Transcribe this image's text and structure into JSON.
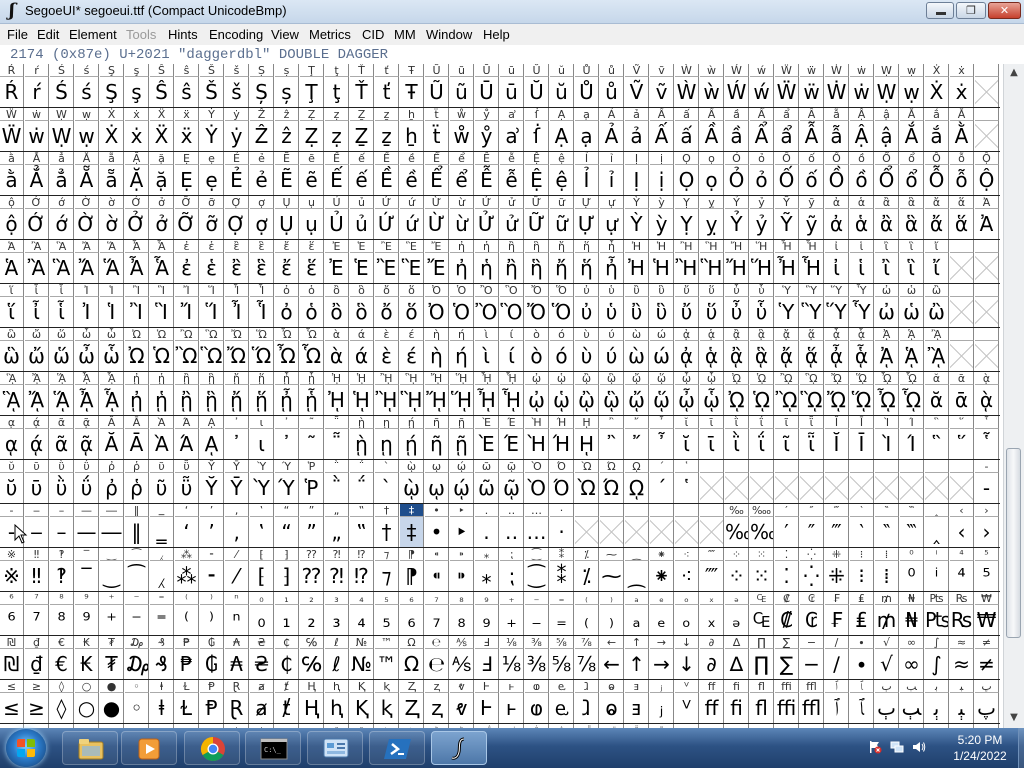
{
  "window": {
    "title": "SegoeUI* segoeui.ttf (Compact UnicodeBmp)",
    "app_icon_glyph": "ʃ",
    "min_label": "–",
    "max_label": "❐",
    "close_label": "✕"
  },
  "menu": [
    {
      "label": "File",
      "disabled": false
    },
    {
      "label": "Edit",
      "disabled": false
    },
    {
      "label": "Element",
      "disabled": false
    },
    {
      "label": "Tools",
      "disabled": true
    },
    {
      "label": "Hints",
      "disabled": false
    },
    {
      "label": "Encoding",
      "disabled": false
    },
    {
      "label": "View",
      "disabled": false
    },
    {
      "label": "Metrics",
      "disabled": false
    },
    {
      "label": "CID",
      "disabled": false
    },
    {
      "label": "MM",
      "disabled": false
    },
    {
      "label": "Window",
      "disabled": false
    },
    {
      "label": "Help",
      "disabled": false
    }
  ],
  "info": "2174 (0x87e) U+2021 \"daggerdbl\" DOUBLE DAGGER",
  "grid": {
    "rows": [
      "Ŕ ŕ Ś ś Ş ş Ŝ ŝ Š š Ș ș Ţ ţ Ť ť Ŧ Ũ ũ Ū ū Ŭ ŭ Ů ů Ṽ ṽ Ẁ ẁ Ẃ ẃ Ẅ ẅ Ẇ ẇ Ẉ ẉ Ẋ ẋ",
      "Ẅ ẇ Ẉ ẉ Ẋ ẋ Ẍ ẍ Ẏ ẏ Ẑ ẑ Ẓ ẓ Ẕ ẕ ẖ ẗ ẘ ẙ ẚ ẛ Ạ ạ Ả ả Ấ ấ Ầ ầ Ẩ ẩ Ẫ ẫ Ậ ậ Ắ ắ Ằ",
      "ằ Ẳ ẳ Ẵ ẵ Ặ ặ Ẹ ẹ Ẻ ẻ Ẽ ẽ Ế ế Ề ề Ể ể Ễ ễ Ệ ệ Ỉ ỉ Ị ị Ọ ọ Ỏ ỏ Ố ố Ồ ồ Ổ ổ Ỗ ỗ Ộ",
      "ộ Ớ ớ Ờ ờ Ở ở Ỡ ỡ Ợ ợ Ụ ụ Ủ ủ Ứ ứ Ừ ừ Ử ử Ữ ữ Ự ự Ỳ ỳ Ỵ ỵ Ỷ ỷ Ỹ ỹ ἀ ἁ ἂ ἃ ἄ ἅ Ἀ",
      "Ἁ Ἂ Ἃ Ἄ Ἅ Ἆ Ἇ ἐ ἑ ἒ ἓ ἔ ἕ Ἐ Ἑ Ἒ Ἓ Ἔ ἠ ἡ ἢ ἣ ἤ ἥ ἦ Ἠ Ἡ Ἢ Ἣ Ἤ Ἥ Ἦ Ἧ ἰ ἱ ἲ ἳ ἴ",
      "ἵ ἶ ἷ Ἰ Ἱ Ἲ Ἳ Ἴ Ἵ Ἶ Ἷ ὀ ὁ ὂ ὃ ὄ ὅ Ὀ Ὁ Ὂ Ὃ Ὄ Ὅ ὐ ὑ ὒ ὓ ὔ ὕ ὖ ὗ Ὑ Ὓ Ὕ Ὗ ὠ ὡ ὢ",
      "ὣ ὤ ὥ ὦ ὧ Ὠ Ὡ Ὢ Ὣ Ὤ Ὥ Ὦ Ὧ ὰ ά ὲ έ ὴ ή ὶ ί ὸ ό ὺ ύ ὼ ώ ᾀ ᾁ ᾂ ᾃ ᾄ ᾅ ᾆ ᾇ ᾈ ᾉ ᾊ",
      "ᾋ ᾌ ᾍ ᾎ ᾏ ᾐ ᾑ ᾒ ᾓ ᾔ ᾕ ᾖ ᾗ ᾘ ᾙ ᾚ ᾛ ᾜ ᾝ ᾞ ᾟ ᾠ ᾡ ᾢ ᾣ ᾤ ᾥ ᾦ ᾧ ᾨ ᾩ ᾪ ᾫ ᾬ ᾭ ᾮ ᾯ ᾰ ᾱ ᾲ",
      "ᾳ ᾴ ᾶ ᾷ Ᾰ Ᾱ Ὰ Ά ᾼ ᾽ ι ᾿ ῀ ῁ ῂ ῃ ῄ ῆ ῇ Ὲ Έ Ὴ Ή ῌ ῍ ῎ ῏ ῐ ῑ ῒ ΐ ῖ ῗ Ῐ Ῑ Ὶ Ί ῝ ῞ ῟",
      "ῠ ῡ ῢ ΰ ῤ ῥ ῦ ῧ Ῠ Ῡ Ὺ Ύ Ῥ ῭ ΅ ` ῲ ῳ ῴ ῶ ῷ Ὸ Ό Ὼ Ώ ῼ ´ ῾ ␣ ␣ ␣ ␣ ␣ ␣ ␣ ␣ ␣ ␣ ␣ ‐",
      "‑ ‒ – — ― ‖ ‗ ‘ ’ ‚ ‛ “ ” „ ‟ † ‡ • ‣ ․ ‥ … ‧ ␣ ␣ ␣ ␣ ␣ ␣ ‰ ‱ ′ ″ ‴ ‵ ‶ ‷ ‸ ‹ ›",
      "※ ‼ ‽ ‾ ‿ ⁀ ⁁ ⁂ ⁃ ⁄ ⁅ ⁆ ⁇ ⁈ ⁉ ⁊ ⁋ ⁌ ⁍ ⁎ ⁏ ⁐ ⁑ ⁒ ⁓ ⁔ ⁕ ⁖ ⁗ ⁘ ⁙ ⁚ ⁛ ⁜ ⁝ ⁞ ⁰ ⁱ ⁴ ⁵",
      "⁶ ⁷ ⁸ ⁹ ⁺ ⁻ ⁼ ⁽ ⁾ ⁿ ₀ ₁ ₂ ₃ ₄ ₅ ₆ ₇ ₈ ₉ ₊ ₋ ₌ ₍ ₎ ₐ ₑ ₒ ₓ ₔ ₠ ₡ ₢ ₣ ₤ ₥ ₦ ₧ ₨ ₩",
      "₪ ₫ € ₭ ₮ ₯ ₰ ₱ ₲ ₳ ₴ ₵ ℅ ℓ № ™ Ω ℮ ⅍ Ⅎ ⅛ ⅜ ⅝ ⅞ ← ↑ → ↓ ∂ ∆ ∏ ∑ − ∕ ∙ √ ∞ ∫ ≈ ≠",
      "≤ ≥ ◊ ○ ● ◦ ⱡ Ɫ Ᵽ Ɽ ⱥ ⱦ Ⱨ ⱨ Ⱪ ⱪ Ⱬ ⱬ ⱴ Ⱶ ⱶ ⱷ ⱸ ⱹ ⱺ ⱻ ⱼ ⱽ ﬀ ﬁ ﬂ ﬃ ﬄ ﭐ ﭑ ﭒ ﭓ ﭔ ﭕ ﭖ",
      "ﭗ ﭘ ﭙ ﭚ ﭛ ﭜ ﭝ ﭞ ﭟ ﭠ ﭡ ﭢ ﭣ ﭤ ﭥ ﭦ ﭧ ﭨ ﭩ ﭪ ﭫ ﭬ ﭭ ﭮ ﭯ ﭰ ﭱ ﭲ ﭳ ﭴ ﭵ ﭶ ﭷ ﭸ ﭹ ﭺ ﭻ ﭼ ﭽ ﭾ"
    ],
    "selected_index": 416
  },
  "scrollbar": {
    "up": "▲",
    "down": "▼"
  },
  "taskbar": {
    "clock_time": "5:20 PM",
    "clock_date": "1/24/2022",
    "buttons": [
      {
        "name": "explorer",
        "active": false
      },
      {
        "name": "media-player",
        "active": false
      },
      {
        "name": "chrome",
        "active": false
      },
      {
        "name": "cmd",
        "active": false
      },
      {
        "name": "control-panel",
        "active": false
      },
      {
        "name": "powershell",
        "active": false
      },
      {
        "name": "fontforge",
        "active": true
      }
    ]
  },
  "colors": {
    "selection": "#1f4e8c",
    "taskbar": "#2d5284",
    "info_text": "#5b6f8f"
  }
}
